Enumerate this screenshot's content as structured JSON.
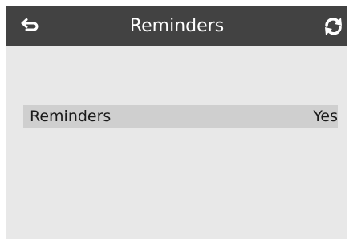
{
  "header": {
    "title": "Reminders",
    "back_icon": "back-arrow-icon",
    "refresh_icon": "refresh-icon"
  },
  "settings": {
    "items": [
      {
        "label": "Reminders",
        "value": "Yes"
      }
    ]
  },
  "colors": {
    "header_bg": "#424242",
    "screen_bg": "#e8e8e8",
    "row_bg": "#cfcfcf",
    "header_text": "#ffffff"
  }
}
